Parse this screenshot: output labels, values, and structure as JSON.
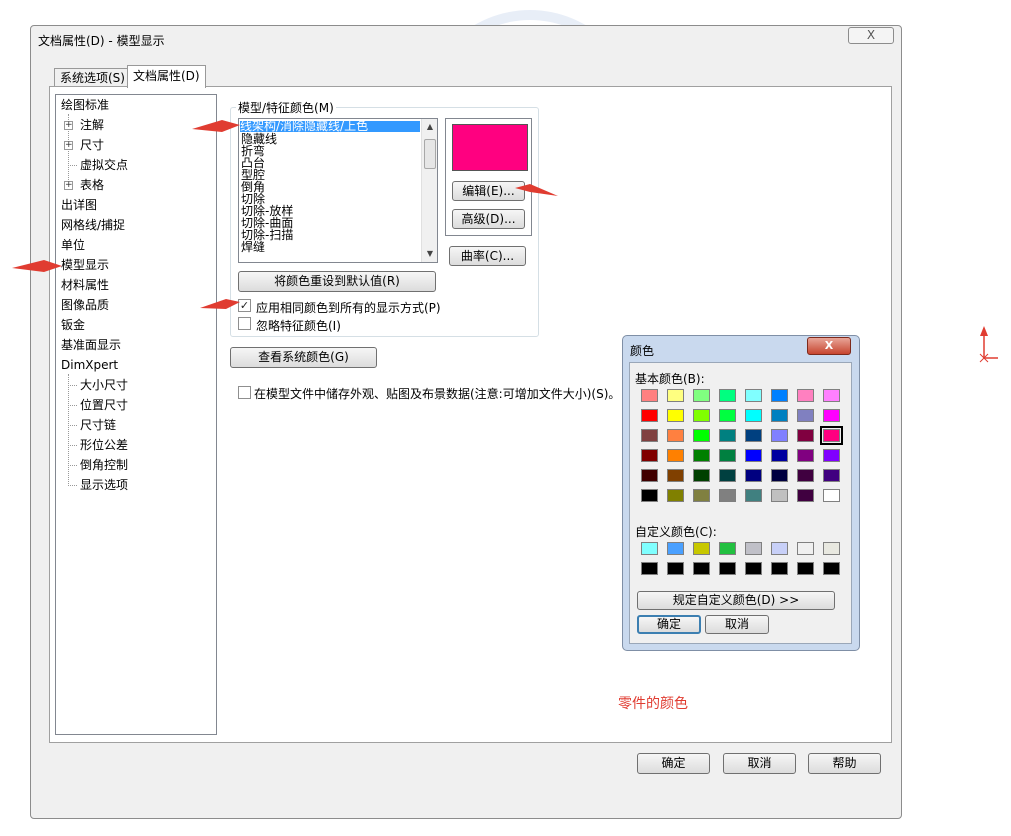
{
  "dialog": {
    "title": "文档属性(D) - 模型显示",
    "close_glyph": "X",
    "tabs": [
      {
        "label": "系统选项(S)",
        "active": false
      },
      {
        "label": "文档属性(D)",
        "active": true
      }
    ]
  },
  "tree": {
    "items": [
      {
        "label": "绘图标准"
      },
      {
        "label": "注解",
        "expand": "+"
      },
      {
        "label": "尺寸",
        "expand": "+"
      },
      {
        "label": "虚拟交点"
      },
      {
        "label": "表格",
        "expand": "+"
      },
      {
        "label": "出详图"
      },
      {
        "label": "网格线/捕捉"
      },
      {
        "label": "单位"
      },
      {
        "label": "模型显示"
      },
      {
        "label": "材料属性"
      },
      {
        "label": "图像品质"
      },
      {
        "label": "钣金"
      },
      {
        "label": "基准面显示"
      },
      {
        "label": "DimXpert"
      },
      {
        "label": "大小尺寸"
      },
      {
        "label": "位置尺寸"
      },
      {
        "label": "尺寸链"
      },
      {
        "label": "形位公差"
      },
      {
        "label": "倒角控制"
      },
      {
        "label": "显示选项"
      }
    ]
  },
  "model_colors": {
    "group_label": "模型/特征颜色(M)",
    "list_items": [
      "线架构/消除隐藏线/上色",
      "隐藏线",
      "折弯",
      "凸台",
      "型腔",
      "倒角",
      "切除",
      "切除-放样",
      "切除-曲面",
      "切除-扫描",
      "焊缝"
    ],
    "selected_index": 0,
    "swatch_color": "#ff0080",
    "edit_button": "编辑(E)...",
    "advanced_button": "高级(D)...",
    "curvature_button": "曲率(C)...",
    "reset_button": "将颜色重设到默认值(R)",
    "apply_same_color": {
      "label": "应用相同颜色到所有的显示方式(P)",
      "checked": true
    },
    "ignore_feature_color": {
      "label": "忽略特征颜色(I)",
      "checked": false
    },
    "check_glyph": "✓"
  },
  "view_system_colors_button": "查看系统颜色(G)",
  "store_appearance": {
    "label": "在模型文件中储存外观、贴图及布景数据(注意:可增加文件大小)(S)。",
    "checked": false
  },
  "footer": {
    "ok": "确定",
    "cancel": "取消",
    "help": "帮助"
  },
  "color_dialog": {
    "title": "颜色",
    "close_glyph": "X",
    "basic_label": "基本颜色(B):",
    "basic_colors": [
      [
        "#ff8080",
        "#ffff80",
        "#80ff80",
        "#00ff80",
        "#80ffff",
        "#0080ff",
        "#ff80c0",
        "#ff80ff"
      ],
      [
        "#ff0000",
        "#ffff00",
        "#80ff00",
        "#00ff40",
        "#00ffff",
        "#0080c0",
        "#8080c0",
        "#ff00ff"
      ],
      [
        "#804040",
        "#ff8040",
        "#00ff00",
        "#008080",
        "#004080",
        "#8080ff",
        "#800040",
        "#ff0080"
      ],
      [
        "#800000",
        "#ff8000",
        "#008000",
        "#008040",
        "#0000ff",
        "#0000a0",
        "#800080",
        "#8000ff"
      ],
      [
        "#400000",
        "#804000",
        "#004000",
        "#004040",
        "#000080",
        "#000040",
        "#400040",
        "#400080"
      ],
      [
        "#000000",
        "#808000",
        "#808040",
        "#808080",
        "#408080",
        "#c0c0c0",
        "#400040",
        "#ffffff"
      ]
    ],
    "selected_basic": [
      2,
      7
    ],
    "custom_label": "自定义颜色(C):",
    "custom_colors": [
      [
        "#80ffff",
        "#4aa0ff",
        "#c8c800",
        "#22c040",
        "#c0c0c8",
        "#c8d0f8",
        "#f0f0f0",
        "#e8e8e0"
      ],
      [
        "#000000",
        "#000000",
        "#000000",
        "#000000",
        "#000000",
        "#000000",
        "#000000",
        "#000000"
      ]
    ],
    "define_custom_button": "规定自定义颜色(D) >>",
    "ok": "确定",
    "cancel": "取消"
  },
  "annotation_text": "零件的颜色",
  "accent_arrow_color": "#e03c31"
}
